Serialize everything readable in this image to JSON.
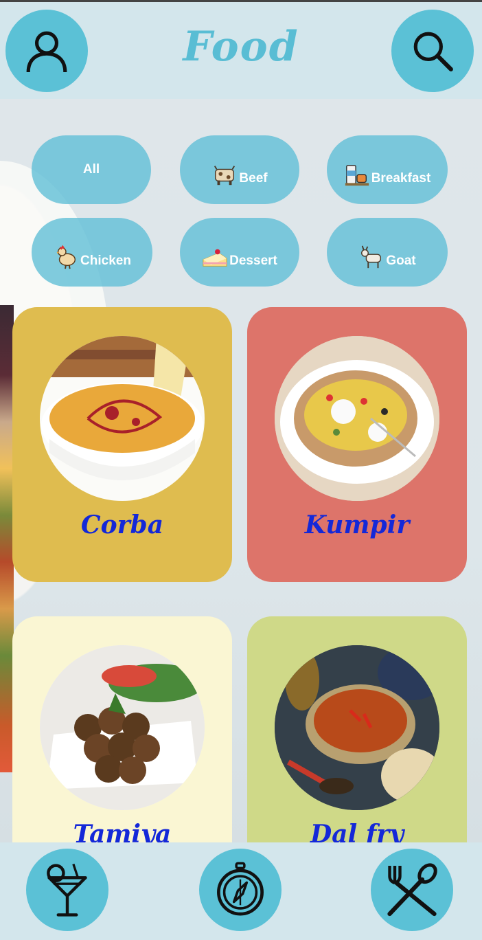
{
  "header": {
    "title": "Food",
    "profile_icon": "user-icon",
    "search_icon": "search-icon"
  },
  "categories": [
    {
      "label": "All",
      "icon": ""
    },
    {
      "label": "Beef",
      "icon": "cow-icon"
    },
    {
      "label": "Breakfast",
      "icon": "breakfast-icon"
    },
    {
      "label": "Chicken",
      "icon": "chicken-icon"
    },
    {
      "label": "Dessert",
      "icon": "cake-icon"
    },
    {
      "label": "Goat",
      "icon": "goat-icon"
    }
  ],
  "dishes": [
    {
      "name": "Corba",
      "color": "#dfbc4f"
    },
    {
      "name": "Kumpir",
      "color": "#dd746a"
    },
    {
      "name": "Tamiya",
      "color": "#faf6d3"
    },
    {
      "name": "Dal fry",
      "color": "#cfd988"
    }
  ],
  "footer": {
    "items": [
      "cocktail-icon",
      "compass-icon",
      "fork-spoon-icon"
    ]
  },
  "colors": {
    "accent": "#5bc1d6",
    "header_bg": "#d3e6ec",
    "title": "#59bdd4",
    "dish_name": "#1428d8"
  }
}
